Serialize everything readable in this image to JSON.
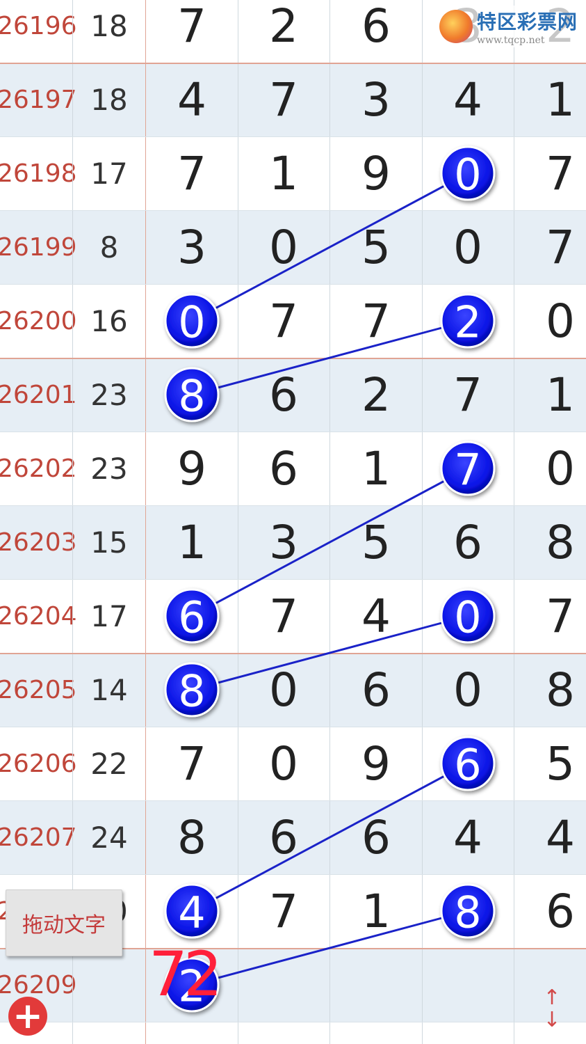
{
  "site_logo": {
    "name": "特区彩票网",
    "url": "www.tqcp.net"
  },
  "rows": [
    {
      "issue": "26196",
      "sum": "18",
      "digits": [
        "7",
        "2",
        "6",
        "3",
        "2"
      ],
      "circled": []
    },
    {
      "issue": "26197",
      "sum": "18",
      "digits": [
        "4",
        "7",
        "3",
        "4",
        "1"
      ],
      "circled": []
    },
    {
      "issue": "26198",
      "sum": "17",
      "digits": [
        "7",
        "1",
        "9",
        "0",
        "7"
      ],
      "circled": [
        3
      ]
    },
    {
      "issue": "26199",
      "sum": "8",
      "digits": [
        "3",
        "0",
        "5",
        "0",
        "7"
      ],
      "circled": []
    },
    {
      "issue": "26200",
      "sum": "16",
      "digits": [
        "0",
        "7",
        "7",
        "2",
        "0"
      ],
      "circled": [
        0,
        3
      ]
    },
    {
      "issue": "26201",
      "sum": "23",
      "digits": [
        "8",
        "6",
        "2",
        "7",
        "1"
      ],
      "circled": [
        0
      ]
    },
    {
      "issue": "26202",
      "sum": "23",
      "digits": [
        "9",
        "6",
        "1",
        "7",
        "0"
      ],
      "circled": [
        3
      ]
    },
    {
      "issue": "26203",
      "sum": "15",
      "digits": [
        "1",
        "3",
        "5",
        "6",
        "8"
      ],
      "circled": []
    },
    {
      "issue": "26204",
      "sum": "17",
      "digits": [
        "6",
        "7",
        "4",
        "0",
        "7"
      ],
      "circled": [
        0,
        3
      ]
    },
    {
      "issue": "26205",
      "sum": "14",
      "digits": [
        "8",
        "0",
        "6",
        "0",
        "8"
      ],
      "circled": [
        0
      ]
    },
    {
      "issue": "26206",
      "sum": "22",
      "digits": [
        "7",
        "0",
        "9",
        "6",
        "5"
      ],
      "circled": [
        3
      ]
    },
    {
      "issue": "26207",
      "sum": "24",
      "digits": [
        "8",
        "6",
        "6",
        "4",
        "4"
      ],
      "circled": []
    },
    {
      "issue": "26208",
      "sum": "20",
      "digits": [
        "4",
        "7",
        "1",
        "8",
        "6"
      ],
      "circled": [
        0,
        3
      ]
    },
    {
      "issue": "26209",
      "sum": "",
      "digits": [
        "2",
        "",
        "",
        "",
        ""
      ],
      "circled": [
        0
      ]
    }
  ],
  "connectors": [
    {
      "from": {
        "row": 4,
        "col": 0
      },
      "to": {
        "row": 2,
        "col": 3
      }
    },
    {
      "from": {
        "row": 5,
        "col": 0
      },
      "to": {
        "row": 4,
        "col": 3
      }
    },
    {
      "from": {
        "row": 8,
        "col": 0
      },
      "to": {
        "row": 6,
        "col": 3
      }
    },
    {
      "from": {
        "row": 9,
        "col": 0
      },
      "to": {
        "row": 8,
        "col": 3
      }
    },
    {
      "from": {
        "row": 12,
        "col": 0
      },
      "to": {
        "row": 10,
        "col": 3
      }
    },
    {
      "from": {
        "row": 13,
        "col": 0
      },
      "to": {
        "row": 12,
        "col": 3
      }
    }
  ],
  "prediction_mark": "72",
  "drag_text_button": {
    "label": "拖动文字"
  },
  "add_button": {
    "icon": "plus-icon",
    "label": "+"
  },
  "scroll_toggle": {
    "icon": "up-down-arrows-icon",
    "up": "↑",
    "down": "↓"
  },
  "colors": {
    "ball": "#0a14e6",
    "connector": "#1a22c8",
    "issue_text": "#c0463a",
    "alt_row": "#e6eef5",
    "prediction": "#ff1f3a"
  }
}
